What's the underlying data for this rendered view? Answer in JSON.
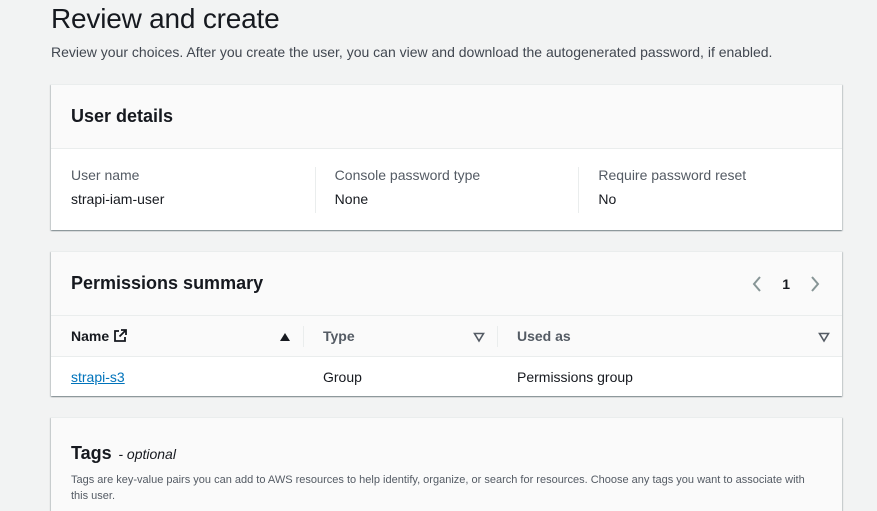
{
  "page": {
    "title": "Review and create",
    "description": "Review your choices. After you create the user, you can view and download the autogenerated password, if enabled."
  },
  "user_details": {
    "title": "User details",
    "fields": [
      {
        "label": "User name",
        "value": "strapi-iam-user"
      },
      {
        "label": "Console password type",
        "value": "None"
      },
      {
        "label": "Require password reset",
        "value": "No"
      }
    ]
  },
  "permissions": {
    "title": "Permissions summary",
    "pager": {
      "current_page": "1"
    },
    "columns": {
      "name": "Name",
      "type": "Type",
      "used_as": "Used as"
    },
    "rows": [
      {
        "name": "strapi-s3",
        "type": "Group",
        "used_as": "Permissions group"
      }
    ]
  },
  "tags": {
    "title": "Tags",
    "optional": "- optional",
    "description": "Tags are key-value pairs you can add to AWS resources to help identify, organize, or search for resources. Choose any tags you want to associate with this user."
  },
  "icons": {
    "sort_ascending": "caret-up-filled-icon",
    "sort_descending": "caret-down-outline-icon",
    "external_link": "external-link-icon",
    "pager_prev": "chevron-left-icon",
    "pager_next": "chevron-right-icon"
  }
}
